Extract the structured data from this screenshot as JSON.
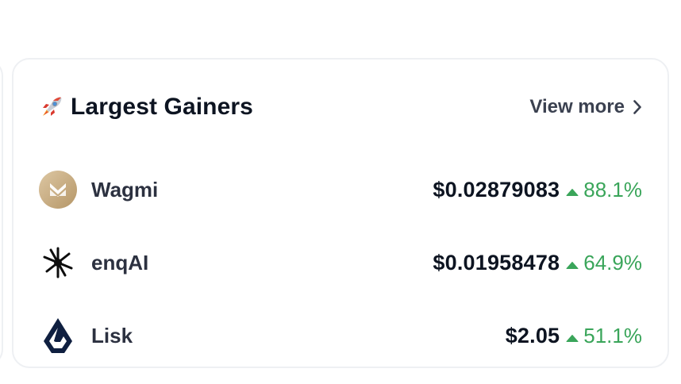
{
  "widget": {
    "title": "Largest Gainers",
    "title_icon": "rocket-icon",
    "view_more_label": "View more",
    "view_more_icon": "chevron-right-icon"
  },
  "colors": {
    "positive": "#3aa55a",
    "title": "#0d1421",
    "border": "#eef0f3"
  },
  "gainers": [
    {
      "name": "Wagmi",
      "logo": "wagmi-logo",
      "price": "$0.02879083",
      "change": "88.1%",
      "direction": "up"
    },
    {
      "name": "enqAI",
      "logo": "enqai-logo",
      "price": "$0.01958478",
      "change": "64.9%",
      "direction": "up"
    },
    {
      "name": "Lisk",
      "logo": "lisk-logo",
      "price": "$2.05",
      "change": "51.1%",
      "direction": "up"
    }
  ]
}
